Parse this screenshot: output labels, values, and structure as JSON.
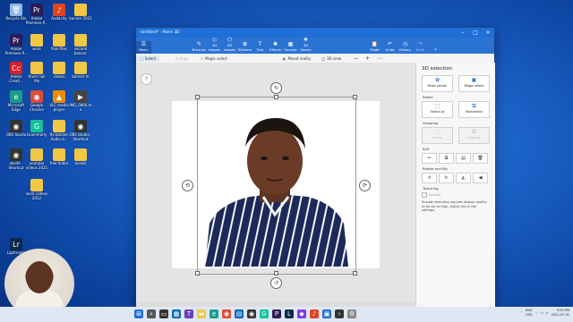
{
  "desktop": {
    "icons": [
      {
        "label": "Recycle Bin",
        "color": "#8fb8e8",
        "glyph": "🗑"
      },
      {
        "label": "Adobe Premiere P...",
        "color": "#2b1b57",
        "glyph": "Pr"
      },
      {
        "label": "Audacity",
        "color": "#e04420",
        "glyph": "♪"
      },
      {
        "label": "banner 2021",
        "color": "#f2c744",
        "glyph": ""
      },
      {
        "label": "Adobe Premiere P...",
        "color": "#2b1b57",
        "glyph": "Pr"
      },
      {
        "label": "work",
        "color": "#f2c744",
        "glyph": ""
      },
      {
        "label": "final files",
        "color": "#f2c744",
        "glyph": ""
      },
      {
        "label": "second banner",
        "color": "#f2c744",
        "glyph": ""
      },
      {
        "label": "Adobe Creati...",
        "color": "#da1f26",
        "glyph": "Cc"
      },
      {
        "label": "thum nail file",
        "color": "#f2c744",
        "glyph": ""
      },
      {
        "label": "videos",
        "color": "#f2c744",
        "glyph": ""
      },
      {
        "label": "banner m",
        "color": "#f2c744",
        "glyph": ""
      },
      {
        "label": "Microsoft Edge",
        "color": "#1a9c8a",
        "glyph": "e"
      },
      {
        "label": "Google Chrome",
        "color": "#dd4b39",
        "glyph": "◉"
      },
      {
        "label": "VLC media player",
        "color": "#f08a00",
        "glyph": "▲"
      },
      {
        "label": "IMG_0866.mo",
        "color": "#444",
        "glyph": "▶"
      },
      {
        "label": "OBS Studio",
        "color": "#333",
        "glyph": "◉"
      },
      {
        "label": "Grammarly",
        "color": "#15c39a",
        "glyph": "G"
      },
      {
        "label": "fiv banner Audio d...",
        "color": "#f2c744",
        "glyph": ""
      },
      {
        "label": "OBS Studio - Shortcut",
        "color": "#333",
        "glyph": "◉"
      },
      {
        "label": "obsdit - Shortcut",
        "color": "#333",
        "glyph": "◉"
      },
      {
        "label": "youtube videos 2021",
        "color": "#f2c744",
        "glyph": ""
      },
      {
        "label": "free folder",
        "color": "#f2c744",
        "glyph": ""
      },
      {
        "label": "ovalas",
        "color": "#f2c744",
        "glyph": ""
      },
      {
        "label": "work videos 2012",
        "color": "#f2c744",
        "glyph": ""
      },
      {
        "label": "Lightroom",
        "color": "#0a2a4a",
        "glyph": "Lr"
      }
    ]
  },
  "window": {
    "title": "Untitled* - Paint 3D",
    "ribbon": [
      {
        "label": "Menu",
        "icon": "☰"
      },
      {
        "label": "Brushes",
        "icon": "✎"
      },
      {
        "label": "2D shapes",
        "icon": "◇"
      },
      {
        "label": "3D shapes",
        "icon": "⬡"
      },
      {
        "label": "Stickers",
        "icon": "✿"
      },
      {
        "label": "Text",
        "icon": "T"
      },
      {
        "label": "Effects",
        "icon": "✺"
      },
      {
        "label": "Canvas",
        "icon": "▦"
      },
      {
        "label": "3D library",
        "icon": "❖"
      },
      {
        "label": "Paste",
        "icon": "📋"
      },
      {
        "label": "Undo",
        "icon": "↶"
      },
      {
        "label": "History",
        "icon": "◷"
      },
      {
        "label": "Redo",
        "icon": "↷"
      }
    ],
    "toolbar": {
      "select": "Select",
      "crop": "Crop",
      "magic_select": "Magic select",
      "mixed_reality": "Mixed reality",
      "view_3d": "3D view",
      "zoom_out": "−",
      "zoom_in": "+"
    }
  },
  "panel": {
    "title": "3D selection",
    "make_sticker": "Make sticker",
    "magic_select": "Magic select",
    "select_section": "Select",
    "select_all": "Select all",
    "multiselect": "Multiselect",
    "grouping_section": "Grouping",
    "group": "Group",
    "ungroup": "Ungroup",
    "edit_section": "Edit",
    "rotate_section": "Rotate and flip",
    "texturing_section": "Texturing",
    "smooth": "Smooth",
    "note": "Smooth texturing requires display quality to be set to High. Adjust this in the settings."
  },
  "taskbar": {
    "lang": "ENG",
    "region": "CMS",
    "time": "9:55 PM",
    "date": "2022-07-31"
  }
}
